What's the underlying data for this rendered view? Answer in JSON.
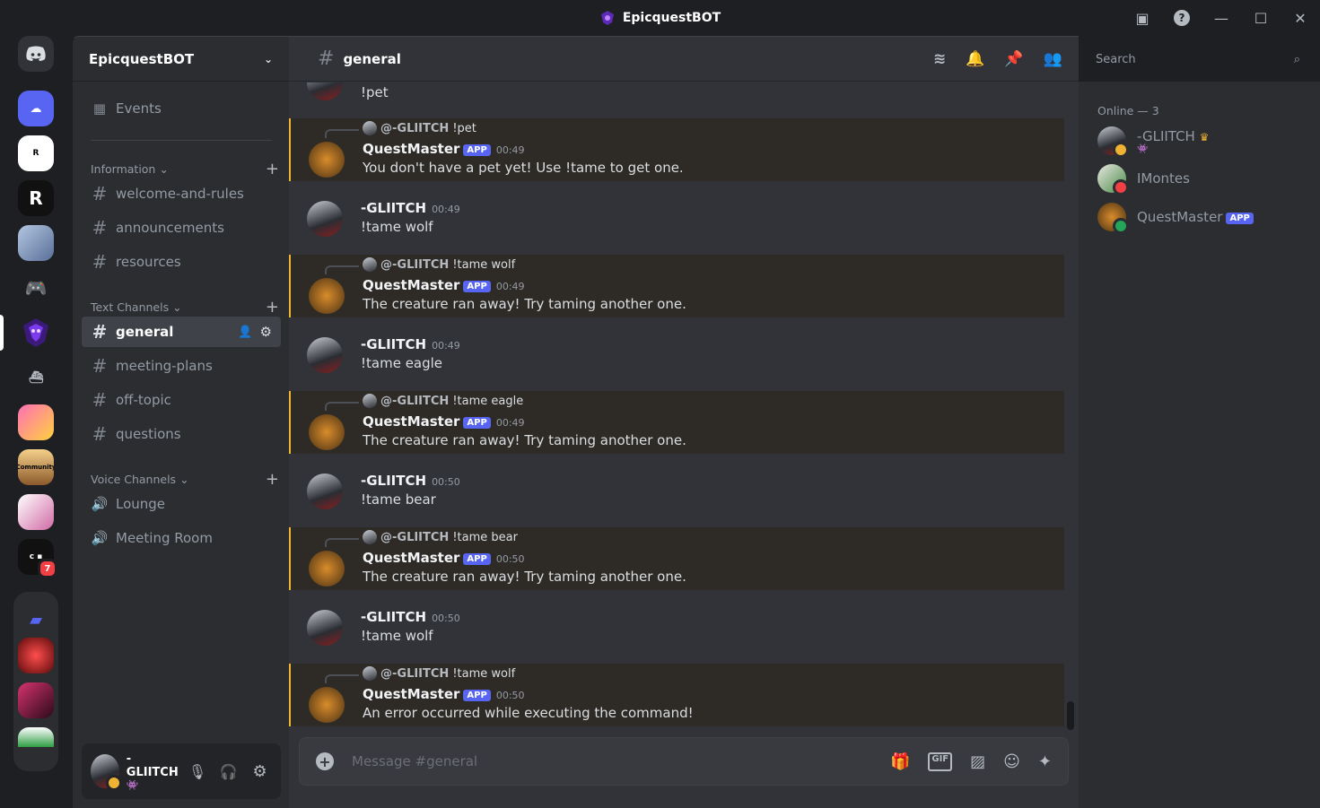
{
  "window": {
    "title": "EpicquestBOT"
  },
  "servers": {
    "dm_label": "Direct Messages",
    "badge_count": "7"
  },
  "sidebar": {
    "server_name": "EpicquestBOT",
    "events_label": "Events",
    "categories": {
      "information": "Information",
      "text": "Text Channels",
      "voice": "Voice Channels"
    },
    "info_channels": [
      "welcome-and-rules",
      "announcements",
      "resources"
    ],
    "text_channels": [
      "general",
      "meeting-plans",
      "off-topic",
      "questions"
    ],
    "voice_channels": [
      "Lounge",
      "Meeting Room"
    ]
  },
  "user_panel": {
    "name": "-GLIITCH"
  },
  "channel": {
    "name": "general",
    "search_placeholder": "Search",
    "composer_placeholder": "Message #general"
  },
  "messages": [
    {
      "type": "user_partial",
      "text": "!pet"
    },
    {
      "type": "bot",
      "reply_to": "@-GLIITCH",
      "reply_text": "!pet",
      "author": "QuestMaster",
      "tag": "APP",
      "time": "00:49",
      "text": "You don't have a pet yet! Use !tame to get one."
    },
    {
      "type": "user",
      "author": "-GLIITCH",
      "time": "00:49",
      "text": "!tame wolf"
    },
    {
      "type": "bot",
      "reply_to": "@-GLIITCH",
      "reply_text": "!tame wolf",
      "author": "QuestMaster",
      "tag": "APP",
      "time": "00:49",
      "text": "The creature ran away! Try taming another one."
    },
    {
      "type": "user",
      "author": "-GLIITCH",
      "time": "00:49",
      "text": "!tame eagle"
    },
    {
      "type": "bot",
      "reply_to": "@-GLIITCH",
      "reply_text": "!tame eagle",
      "author": "QuestMaster",
      "tag": "APP",
      "time": "00:49",
      "text": "The creature ran away! Try taming another one."
    },
    {
      "type": "user",
      "author": "-GLIITCH",
      "time": "00:50",
      "text": "!tame bear"
    },
    {
      "type": "bot",
      "reply_to": "@-GLIITCH",
      "reply_text": "!tame bear",
      "author": "QuestMaster",
      "tag": "APP",
      "time": "00:50",
      "text": "The creature ran away! Try taming another one."
    },
    {
      "type": "user",
      "author": "-GLIITCH",
      "time": "00:50",
      "text": "!tame wolf"
    },
    {
      "type": "bot",
      "reply_to": "@-GLIITCH",
      "reply_text": "!tame wolf",
      "author": "QuestMaster",
      "tag": "APP",
      "time": "00:50",
      "text": "An error occurred while executing the command!"
    }
  ],
  "members": {
    "header": "Online — 3",
    "list": [
      {
        "name": "-GLIITCH",
        "crown": "♛",
        "status_color": "#f0b232"
      },
      {
        "name": "IMontes",
        "status_color": "#f23f43"
      },
      {
        "name": "QuestMaster",
        "tag": "APP",
        "status_color": "#23a55a"
      }
    ]
  },
  "colors": {
    "accent": "#5865f2",
    "bot_highlight": "#f0b232"
  }
}
